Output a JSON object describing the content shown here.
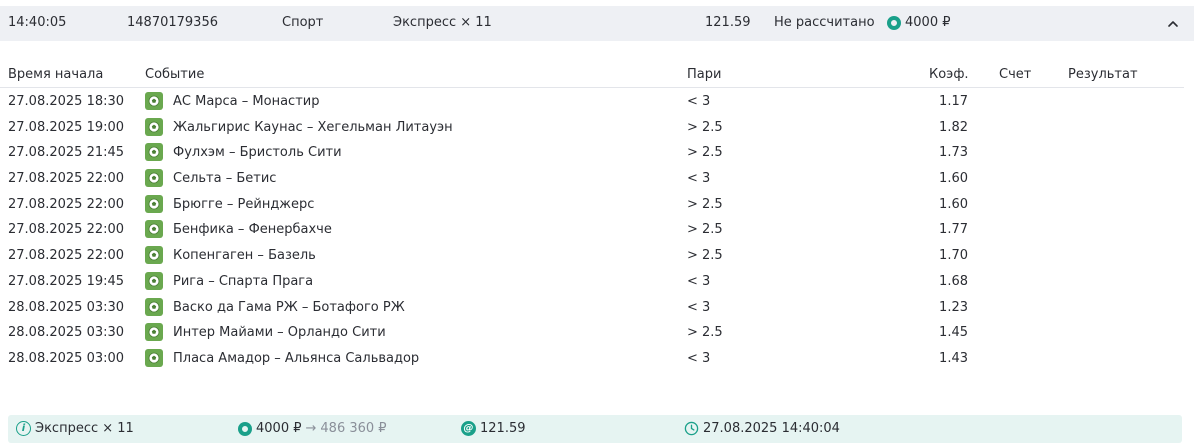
{
  "header": {
    "time": "14:40:05",
    "bet_id": "14870179356",
    "sport": "Спорт",
    "bet_type": "Экспресс × 11",
    "coef": "121.59",
    "status": "Не рассчитано",
    "stake": "4000 ₽"
  },
  "columns": {
    "start": "Время начала",
    "event": "Событие",
    "bet": "Пари",
    "coef": "Коэф.",
    "score": "Счет",
    "result": "Результат"
  },
  "rows": [
    {
      "start": "27.08.2025 18:30",
      "event": "АС Марса – Монастир",
      "bet": "< 3",
      "coef": "1.17"
    },
    {
      "start": "27.08.2025 19:00",
      "event": "Жальгирис Каунас – Хегельман Литауэн",
      "bet": "> 2.5",
      "coef": "1.82"
    },
    {
      "start": "27.08.2025 21:45",
      "event": "Фулхэм – Бристоль Сити",
      "bet": "> 2.5",
      "coef": "1.73"
    },
    {
      "start": "27.08.2025 22:00",
      "event": "Сельта – Бетис",
      "bet": "< 3",
      "coef": "1.60"
    },
    {
      "start": "27.08.2025 22:00",
      "event": "Брюгге – Рейнджерс",
      "bet": "> 2.5",
      "coef": "1.60"
    },
    {
      "start": "27.08.2025 22:00",
      "event": "Бенфика – Фенербахче",
      "bet": "> 2.5",
      "coef": "1.77"
    },
    {
      "start": "27.08.2025 22:00",
      "event": "Копенгаген – Базель",
      "bet": "> 2.5",
      "coef": "1.70"
    },
    {
      "start": "27.08.2025 19:45",
      "event": "Рига – Спарта Прага",
      "bet": "< 3",
      "coef": "1.68"
    },
    {
      "start": "28.08.2025 03:30",
      "event": "Васко да Гама РЖ – Ботафого РЖ",
      "bet": "< 3",
      "coef": "1.23"
    },
    {
      "start": "28.08.2025 03:30",
      "event": "Интер Майами – Орландо Сити",
      "bet": "> 2.5",
      "coef": "1.45"
    },
    {
      "start": "28.08.2025 03:00",
      "event": "Пласа Амадор – Альянса Сальвадор",
      "bet": "< 3",
      "coef": "1.43"
    }
  ],
  "footer": {
    "bet_type": "Экспресс × 11",
    "stake": "4000 ₽",
    "arrow": "→",
    "payout": "486 360 ₽",
    "coef": "121.59",
    "datetime": "27.08.2025 14:40:04"
  },
  "colors": {
    "accent": "#1aa08a",
    "sport_icon": "#6aa84f",
    "header_bg": "#eef0f4",
    "footer_bg": "#e6f4f2"
  },
  "icons": {
    "stake": "coin-icon",
    "collapse": "chevron-up-icon",
    "sport": "soccer-ball-icon",
    "info": "info-icon",
    "coef": "at-icon",
    "time": "clock-icon"
  }
}
